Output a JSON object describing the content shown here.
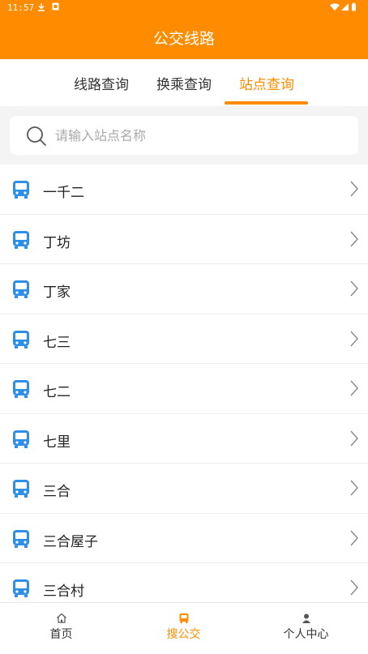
{
  "status": {
    "time": "11:57"
  },
  "header": {
    "title": "公交线路"
  },
  "tabs": [
    {
      "label": "线路查询"
    },
    {
      "label": "换乘查询"
    },
    {
      "label": "站点查询"
    }
  ],
  "search": {
    "placeholder": "请输入站点名称",
    "value": ""
  },
  "stations": [
    {
      "name": "一千二"
    },
    {
      "name": "丁坊"
    },
    {
      "name": "丁家"
    },
    {
      "name": "七三"
    },
    {
      "name": "七二"
    },
    {
      "name": "七里"
    },
    {
      "name": "三合"
    },
    {
      "name": "三合屋子"
    },
    {
      "name": "三合村"
    }
  ],
  "bottom_nav": [
    {
      "label": "首页",
      "icon": "home-icon"
    },
    {
      "label": "搜公交",
      "icon": "bus-icon"
    },
    {
      "label": "个人中心",
      "icon": "person-icon"
    }
  ],
  "colors": {
    "accent": "#ff8c00",
    "bus_icon": "#2f8fe8"
  }
}
